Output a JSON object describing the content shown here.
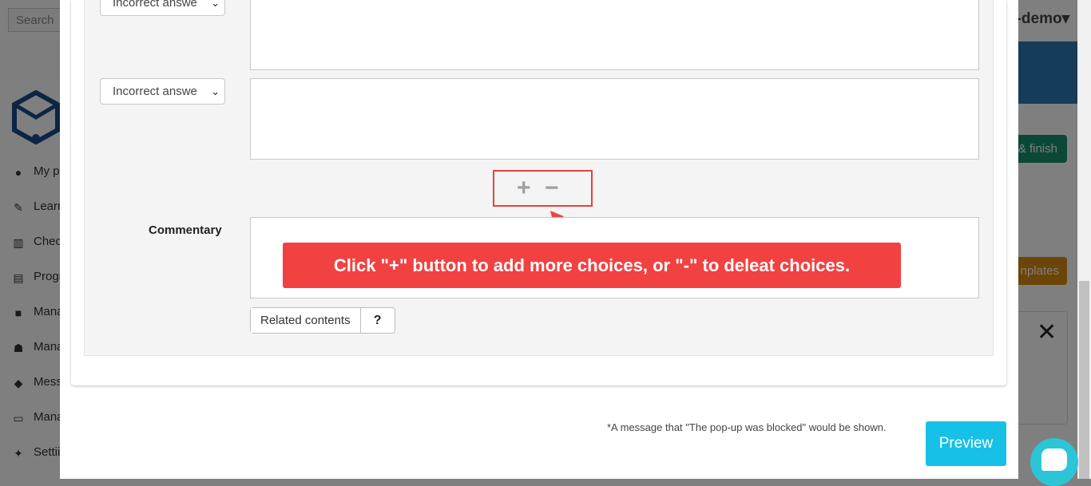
{
  "background": {
    "search_placeholder": "Search",
    "user_name": "e-demo",
    "user_caret": "▾",
    "sidebar_items": [
      {
        "label": "My p",
        "icon": "user-icon"
      },
      {
        "label": "Learn",
        "icon": "pencil-icon"
      },
      {
        "label": "Chec",
        "icon": "bar-chart-icon"
      },
      {
        "label": "Progr",
        "icon": "line-chart-icon"
      },
      {
        "label": "Mana",
        "icon": "folder-icon"
      },
      {
        "label": "Mana",
        "icon": "users-icon"
      },
      {
        "label": "Mess",
        "icon": "comments-icon"
      },
      {
        "label": "Mana",
        "icon": "monitor-icon"
      },
      {
        "label": "Settii",
        "icon": "wrench-icon"
      }
    ],
    "finish_button": "& finish",
    "templates_button": "nplates",
    "close_symbol": "✕"
  },
  "form": {
    "answer_selects": [
      {
        "value": "Incorrect answe"
      },
      {
        "value": "Incorrect answe"
      }
    ],
    "plus_symbol": "+",
    "minus_symbol": "−",
    "commentary_label": "Commentary",
    "related_contents_label": "Related contents",
    "help_label": "?"
  },
  "callout": {
    "text": "Click \"+\" button to add more choices, or \"-\" to deleat choices."
  },
  "footer": {
    "note": "*A message that \"The pop-up was blocked\" would be shown.",
    "preview_label": "Preview"
  },
  "colors": {
    "accent_red": "#f24141",
    "preview_cyan": "#17c0e6",
    "chat_teal": "#2cc5d8"
  }
}
